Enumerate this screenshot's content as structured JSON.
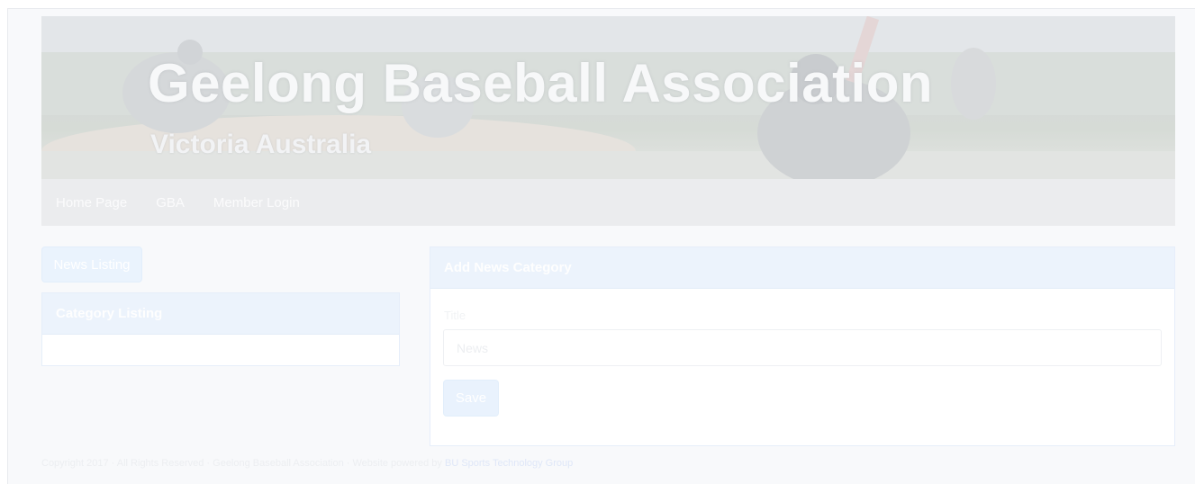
{
  "header": {
    "title": "Geelong Baseball Association",
    "subtitle": "Victoria Australia"
  },
  "nav": {
    "items": [
      {
        "label": "Home Page"
      },
      {
        "label": "GBA"
      },
      {
        "label": "Member Login"
      }
    ]
  },
  "sidebar": {
    "news_listing_button": "News Listing",
    "category_panel_title": "Category Listing"
  },
  "form": {
    "panel_title": "Add News Category",
    "title_label": "Title",
    "title_placeholder": "News",
    "save_label": "Save"
  },
  "footer": {
    "text": "Copyright 2017 · All Rights Reserved · Geelong Baseball Association · Website powered by",
    "link_text": "BU Sports Technology Group"
  }
}
